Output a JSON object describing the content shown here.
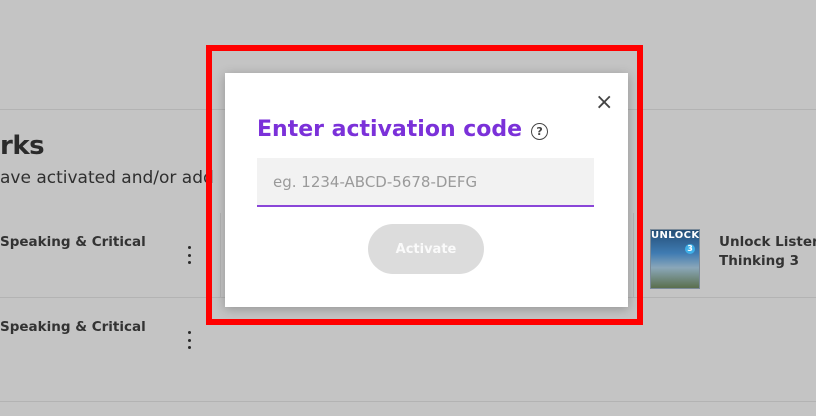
{
  "page": {
    "section_title": "rks",
    "section_subtitle": "ave activated and/or add"
  },
  "books": [
    {
      "title_line1": "Speaking & Critical",
      "title_line2": ""
    },
    {
      "title_line1": "Unlock Listeni",
      "title_line2": "Thinking 3"
    },
    {
      "title_line1": "Speaking & Critical",
      "title_line2": ""
    }
  ],
  "cover": {
    "brand": "UNLOCK",
    "level": "3"
  },
  "modal": {
    "title": "Enter activation code",
    "help_icon": "question-circle-icon",
    "help_glyph": "?",
    "close_icon": "close-icon",
    "close_glyph": "×",
    "input_value": "",
    "input_placeholder": "eg. 1234-ABCD-5678-DEFG",
    "activate_label": "Activate"
  },
  "colors": {
    "accent": "#7b31d9",
    "overlay_bg": "#c4c4c4",
    "highlight": "#ff0000",
    "button_disabled": "#dcdcdc"
  }
}
